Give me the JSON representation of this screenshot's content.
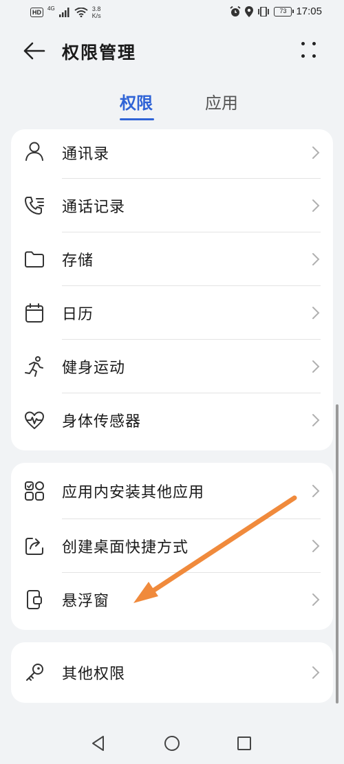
{
  "status_bar": {
    "hd": "HD",
    "network": "4G",
    "speed_value": "3.8",
    "speed_unit": "K/s",
    "battery": "73",
    "time": "17:05"
  },
  "header": {
    "title": "权限管理"
  },
  "tabs": [
    {
      "label": "权限",
      "active": true
    },
    {
      "label": "应用",
      "active": false
    }
  ],
  "groups": [
    {
      "items": [
        {
          "label": "通讯录",
          "icon": "contacts-icon"
        },
        {
          "label": "通话记录",
          "icon": "call-log-icon"
        },
        {
          "label": "存储",
          "icon": "folder-icon"
        },
        {
          "label": "日历",
          "icon": "calendar-icon"
        },
        {
          "label": "健身运动",
          "icon": "running-icon"
        },
        {
          "label": "身体传感器",
          "icon": "heart-rate-icon"
        }
      ]
    },
    {
      "items": [
        {
          "label": "应用内安装其他应用",
          "icon": "app-grid-icon"
        },
        {
          "label": "创建桌面快捷方式",
          "icon": "shortcut-icon"
        },
        {
          "label": "悬浮窗",
          "icon": "floating-window-icon"
        }
      ]
    },
    {
      "items": [
        {
          "label": "其他权限",
          "icon": "key-icon"
        }
      ]
    }
  ],
  "annotation": {
    "arrow_color": "#f08a3c"
  },
  "colors": {
    "accent": "#2f63d6",
    "background": "#f1f3f5"
  }
}
